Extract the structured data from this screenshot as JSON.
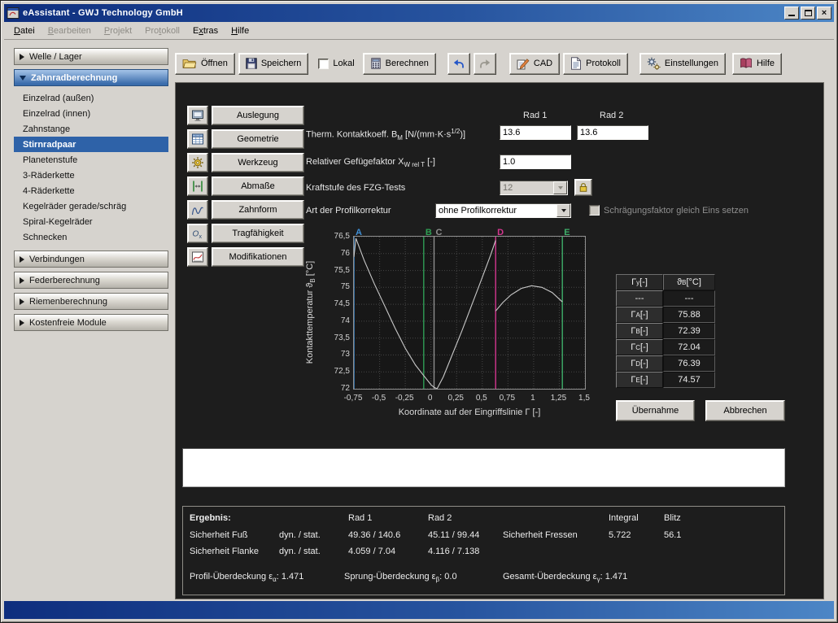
{
  "window": {
    "title": "eAssistant - GWJ Technology GmbH"
  },
  "menu": {
    "items": [
      {
        "label": "Datei",
        "underline": 0,
        "enabled": true
      },
      {
        "label": "Bearbeiten",
        "underline": 0,
        "enabled": false
      },
      {
        "label": "Projekt",
        "underline": 0,
        "enabled": false
      },
      {
        "label": "Protokoll",
        "underline": 3,
        "enabled": false
      },
      {
        "label": "Extras",
        "underline": 1,
        "enabled": true
      },
      {
        "label": "Hilfe",
        "underline": 0,
        "enabled": true
      }
    ]
  },
  "toolbar": {
    "items": [
      {
        "label": "Öffnen",
        "icon": "open-folder-icon"
      },
      {
        "label": "Speichern",
        "icon": "save-floppy-icon"
      },
      {
        "type": "checkbox",
        "label": "Lokal",
        "checked": false,
        "gap": 6
      },
      {
        "label": "Berechnen",
        "icon": "calculator-icon",
        "gap": 4
      },
      {
        "icon": "undo-icon",
        "gap": 10
      },
      {
        "icon": "redo-icon",
        "enabled": false
      },
      {
        "label": "CAD",
        "icon": "cad-icon",
        "gap": 12
      },
      {
        "label": "Protokoll",
        "icon": "document-icon"
      },
      {
        "label": "Einstellungen",
        "icon": "gears-icon",
        "gap": 10
      },
      {
        "label": "Hilfe",
        "icon": "help-book-icon",
        "gap": 4
      }
    ]
  },
  "sidebar": {
    "items": [
      {
        "type": "header",
        "label": "Welle / Lager",
        "expanded": false
      },
      {
        "type": "header",
        "label": "Zahnradberechnung",
        "expanded": true,
        "active": true
      },
      {
        "type": "item",
        "label": "Einzelrad (außen)"
      },
      {
        "type": "item",
        "label": "Einzelrad (innen)"
      },
      {
        "type": "item",
        "label": "Zahnstange"
      },
      {
        "type": "item",
        "label": "Stirnradpaar",
        "selected": true
      },
      {
        "type": "item",
        "label": "Planetenstufe"
      },
      {
        "type": "item",
        "label": "3-Räderkette"
      },
      {
        "type": "item",
        "label": "4-Räderkette"
      },
      {
        "type": "item",
        "label": "Kegelräder gerade/schräg"
      },
      {
        "type": "item",
        "label": "Spiral-Kegelräder"
      },
      {
        "type": "item",
        "label": "Schnecken"
      },
      {
        "type": "header",
        "label": "Verbindungen",
        "expanded": false
      },
      {
        "type": "header",
        "label": "Federberechnung",
        "expanded": false
      },
      {
        "type": "header",
        "label": "Riemenberechnung",
        "expanded": false
      },
      {
        "type": "header",
        "label": "Kostenfreie Module",
        "expanded": false
      }
    ]
  },
  "modules": [
    {
      "label": "Auslegung",
      "icon": "design-icon"
    },
    {
      "label": "Geometrie",
      "icon": "geometry-icon"
    },
    {
      "label": "Werkzeug",
      "icon": "tool-icon"
    },
    {
      "label": "Abmaße",
      "icon": "dimensions-icon"
    },
    {
      "label": "Zahnform",
      "icon": "tooth-form-icon"
    },
    {
      "label": "Tragfähigkeit",
      "icon": "load-capacity-icon"
    },
    {
      "label": "Modifikationen",
      "icon": "modifications-icon"
    }
  ],
  "form": {
    "col1": "Rad 1",
    "col2": "Rad 2",
    "therm": {
      "pre": "Therm. Kontaktkoeff. B",
      "sub": "M",
      "mid": " [N/(mm·K·s",
      "sup": "1/2",
      "post": ")]",
      "value1": "13.6",
      "value2": "13.6"
    },
    "gefuege": {
      "pre": "Relativer Gefügefaktor X",
      "sub": "W rel T",
      "post": " [-]",
      "value": "1.0"
    },
    "fzg": {
      "label": "Kraftstufe des FZG-Tests",
      "value": "12"
    },
    "korrektur": {
      "label": "Art der Profilkorrektur",
      "value": "ohne Profilkorrektur",
      "checkbox_label": "Schrägungsfaktor gleich Eins setzen"
    }
  },
  "chart_data": {
    "type": "line",
    "xlabel": "Koordinate auf der Eingriffslinie Γ [-]",
    "ylabel": "Kontakttemperatur ϑB [°C]",
    "ylabel_parts": {
      "pre": "Kontakttemperatur ϑ",
      "sub": "B",
      "post": " [°C]"
    },
    "xlim": [
      -0.75,
      1.5
    ],
    "ylim": [
      72,
      76.5
    ],
    "grid": true,
    "legend": false,
    "x_ticks": [
      -0.75,
      -0.5,
      -0.25,
      0,
      0.25,
      0.5,
      0.75,
      1,
      1.25,
      1.5
    ],
    "x_tick_labels": [
      "-0,75",
      "-0,5",
      "-0,25",
      "0",
      "0,25",
      "0,5",
      "0,75",
      "1",
      "1,25",
      "1,5"
    ],
    "y_ticks": [
      72,
      72.5,
      73,
      73.5,
      74,
      74.5,
      75,
      75.5,
      76,
      76.5
    ],
    "y_tick_labels": [
      "72",
      "72,5",
      "73",
      "73,5",
      "74",
      "74,5",
      "75",
      "75,5",
      "76",
      "76,5"
    ],
    "markers": [
      {
        "label": "A",
        "x": -0.75,
        "color": "#3f8fd6",
        "value": 75.88
      },
      {
        "label": "B",
        "x": -0.07,
        "color": "#2f9e54",
        "value": 72.39
      },
      {
        "label": "C",
        "x": 0.03,
        "color": "#909090",
        "value": 72.04
      },
      {
        "label": "D",
        "x": 0.63,
        "color": "#d4368f",
        "value": 76.39
      },
      {
        "label": "E",
        "x": 1.28,
        "color": "#3fae6a",
        "value": 74.57
      }
    ],
    "series": [
      {
        "name": "segment-A-D",
        "color": "#c9c9c9",
        "points": [
          [
            -0.75,
            75.9
          ],
          [
            -0.73,
            76.45
          ],
          [
            -0.65,
            75.8
          ],
          [
            -0.55,
            75.1
          ],
          [
            -0.45,
            74.45
          ],
          [
            -0.35,
            73.8
          ],
          [
            -0.25,
            73.2
          ],
          [
            -0.15,
            72.7
          ],
          [
            -0.07,
            72.39
          ],
          [
            0,
            72.12
          ],
          [
            0.03,
            72.04
          ],
          [
            0.06,
            72
          ],
          [
            0.12,
            72.35
          ],
          [
            0.2,
            72.95
          ],
          [
            0.3,
            73.7
          ],
          [
            0.4,
            74.5
          ],
          [
            0.5,
            75.3
          ],
          [
            0.58,
            75.95
          ],
          [
            0.63,
            76.39
          ]
        ]
      },
      {
        "name": "segment-D-E",
        "color": "#c9c9c9",
        "points": [
          [
            0.63,
            74.3
          ],
          [
            0.7,
            74.55
          ],
          [
            0.78,
            74.78
          ],
          [
            0.88,
            74.97
          ],
          [
            0.98,
            75.05
          ],
          [
            1.08,
            75
          ],
          [
            1.18,
            74.85
          ],
          [
            1.28,
            74.57
          ]
        ]
      }
    ]
  },
  "value_table": {
    "header": {
      "col1": {
        "pre": "Γ",
        "sub": "y",
        "post": " [-]"
      },
      "col2": {
        "pre": "ϑ",
        "sub": "B",
        "post": " [°C]"
      }
    },
    "rows": [
      {
        "gamma": "---",
        "value": "---"
      },
      {
        "pre": "Γ",
        "sub": "A",
        "post": " [-]",
        "value": "75.88"
      },
      {
        "pre": "Γ",
        "sub": "B",
        "post": " [-]",
        "value": "72.39"
      },
      {
        "pre": "Γ",
        "sub": "C",
        "post": " [-]",
        "value": "72.04"
      },
      {
        "pre": "Γ",
        "sub": "D",
        "post": " [-]",
        "value": "76.39"
      },
      {
        "pre": "Γ",
        "sub": "E",
        "post": " [-]",
        "value": "74.57"
      }
    ]
  },
  "actions": {
    "apply": "Übernahme",
    "cancel": "Abbrechen"
  },
  "results": {
    "title": "Ergebnis:",
    "columns": {
      "rad1": "Rad 1",
      "rad2": "Rad 2",
      "integral": "Integral",
      "blitz": "Blitz"
    },
    "fuss": {
      "label": "Sicherheit Fuß",
      "mode": "dyn. / stat.",
      "rad1": "49.36 / 140.6",
      "rad2": "45.11 / 99.44"
    },
    "flanke": {
      "label": "Sicherheit Flanke",
      "mode": "dyn. / stat.",
      "rad1": "4.059 / 7.04",
      "rad2": "4.116 / 7.138"
    },
    "fressen": {
      "label": "Sicherheit Fressen",
      "integral": "5.722",
      "blitz": "56.1"
    },
    "profil": {
      "pre": "Profil-Überdeckung ε",
      "sub": "α",
      "sep": ": ",
      "value": "1.471"
    },
    "sprung": {
      "pre": "Sprung-Überdeckung ε",
      "sub": "β",
      "sep": ": ",
      "value": "0.0"
    },
    "gesamt": {
      "pre": "Gesamt-Überdeckung ε",
      "sub": "γ",
      "sep": ": ",
      "value": "1.471"
    }
  }
}
